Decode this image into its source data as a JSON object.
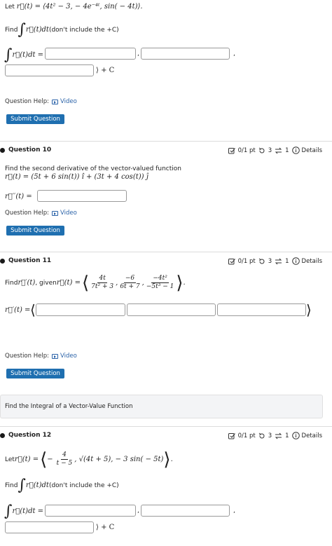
{
  "q9": {
    "let_prefix": "Let ",
    "let_expr": "r⃗(t) = ⟨4t² − 3, − 4e⁻⁴ᵗ, sin( − 4t)⟩.",
    "find_prefix": "Find ",
    "find_int": "∫",
    "find_expr": "r⃗(t)dt",
    "find_note": " (don't include the +C)",
    "answer_lhs_int": "∫",
    "answer_lhs": "r⃗(t)dt = ⟨",
    "comma1": ",",
    "comma2": ",",
    "close": "⟩ + C",
    "help_label": "Question Help:",
    "video_label": "Video",
    "submit_label": "Submit Question"
  },
  "q10": {
    "title": "Question 10",
    "points": "0/1 pt",
    "retries": "3",
    "attempts": "1",
    "details": "Details",
    "prompt": "Find the second derivative of the vector-valued function",
    "function": "r⃗(t) = (5t + 6 sin(t)) î + (3t + 4 cos(t)) ĵ",
    "answer_lhs": "r⃗′′(t) =",
    "help_label": "Question Help:",
    "video_label": "Video",
    "submit_label": "Submit Question"
  },
  "q11": {
    "title": "Question 11",
    "points": "0/1 pt",
    "retries": "3",
    "attempts": "1",
    "details": "Details",
    "prompt_prefix": "Find ",
    "prompt_rprime": "r⃗′(t)",
    "prompt_given": ", given ",
    "prompt_r": "r⃗(t) =",
    "f1_num": "4t",
    "f1_den": "7t² + 3",
    "f2_num": "−6",
    "f2_den": "6t + 7",
    "f3_num": "−4t²",
    "f3_den": "−5t³ − 1",
    "answer_lhs": "r⃗′(t) =",
    "help_label": "Question Help:",
    "video_label": "Video",
    "submit_label": "Submit Question"
  },
  "banner": {
    "text": "Find the Integral of a Vector-Value Function"
  },
  "q12": {
    "title": "Question 12",
    "points": "0/1 pt",
    "retries": "3",
    "attempts": "1",
    "details": "Details",
    "let_prefix": "Let ",
    "let_r": "r⃗(t) =",
    "f1_sign": "−",
    "f1_num": "4",
    "f1_den": "t − 5",
    "rest": ", √(4t + 5), − 3 sin( − 5t)",
    "find_prefix": "Find ",
    "find_int": "∫",
    "find_expr": "r⃗(t)dt",
    "find_note": " (don't include the +C)",
    "answer_lhs_int": "∫",
    "answer_lhs": "r⃗(t)dt = ⟨",
    "comma1": ",",
    "comma2": ",",
    "close": "⟩ + C"
  },
  "colors": {
    "submit_bg": "#1f6fb0",
    "link": "#2a62a8",
    "banner_bg": "#f3f4f6"
  },
  "icons": {
    "video": "video-icon",
    "points": "checkbox-edit-icon",
    "retries": "retry-icon",
    "attempts": "attempts-icon",
    "details": "info-icon"
  }
}
